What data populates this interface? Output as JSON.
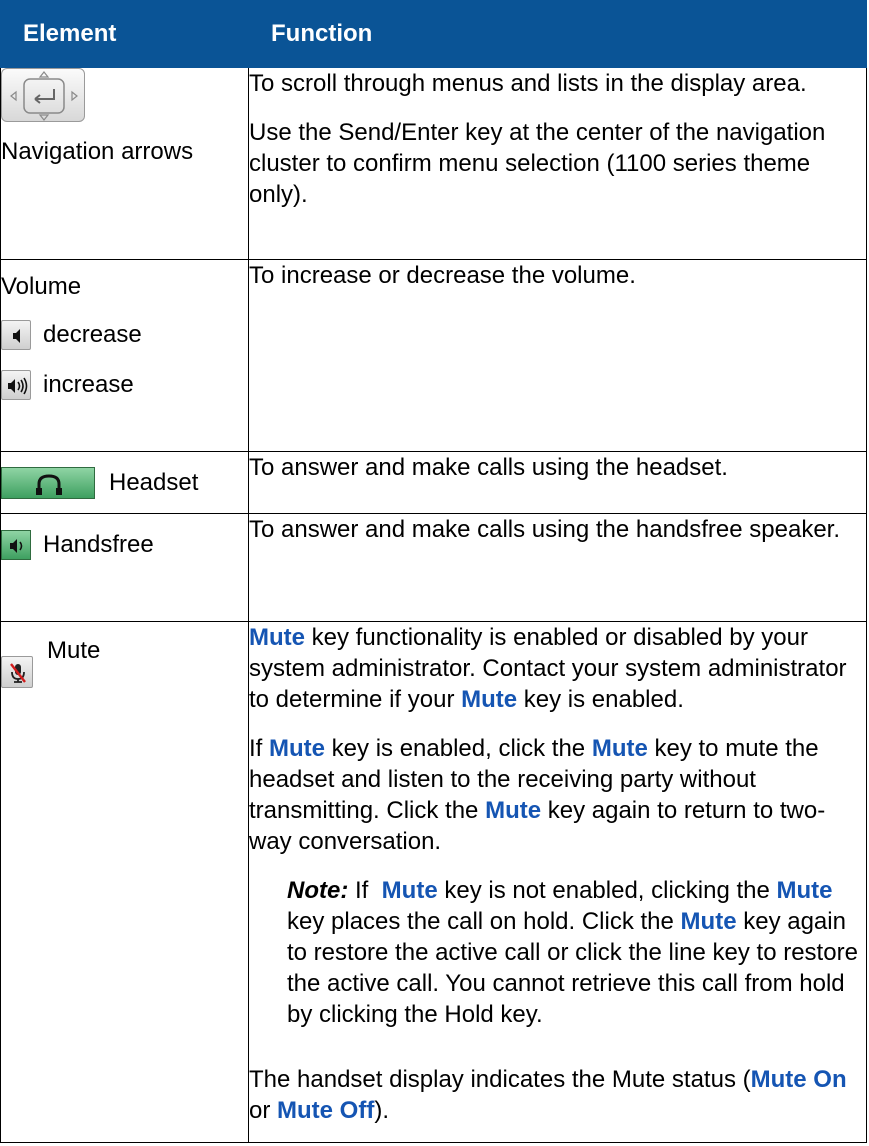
{
  "table": {
    "header": {
      "element": "Element",
      "function": "Function"
    },
    "rows": {
      "nav": {
        "icon": "navigation-arrows-icon",
        "label": "Navigation arrows",
        "p1": "To scroll through menus and lists in the display area.",
        "p2": "Use the Send/Enter key at the center of the navigation cluster to confirm menu selection (1100 series theme only)."
      },
      "volume": {
        "label": "Volume",
        "decrease_icon": "volume-decrease-icon",
        "decrease_label": "decrease",
        "increase_icon": "volume-increase-icon",
        "increase_label": "increase",
        "p1": "To increase or decrease the volume."
      },
      "headset": {
        "icon": "headset-icon",
        "label": "Headset",
        "p1": "To answer and make calls using the headset."
      },
      "handsfree": {
        "icon": "handsfree-icon",
        "label": "Handsfree",
        "p1": "To answer and make calls using the handsfree speaker."
      },
      "mute": {
        "icon": "mute-icon",
        "label": "Mute",
        "key": "Mute",
        "p1_a": " key functionality is enabled or disabled by your system administrator. Contact your system administrator to determine if your ",
        "p1_b": " key is enabled.",
        "p2_a": "If ",
        "p2_b": " key is enabled, click the ",
        "p2_c": " key to mute the headset and listen to the receiving party without transmitting. Click the ",
        "p2_d": " key again to return to two-way conversation.",
        "note_label": "Note:",
        "note_a": " If  ",
        "note_b": " key is not enabled, clicking the ",
        "note_c": " key places the call on hold. Click the ",
        "note_d": " key again to restore the active call or click the line key to restore the active call. You cannot retrieve this call from hold by clicking the Hold key.",
        "p3_a": "The handset display indicates the Mute status (",
        "mute_on": "Mute On",
        "p3_or": " or ",
        "mute_off": "Mute Off",
        "p3_end": ")."
      }
    }
  },
  "colors": {
    "header_bg": "#0a5496",
    "keyword": "#1555b3",
    "green_key": "#3ea060"
  }
}
